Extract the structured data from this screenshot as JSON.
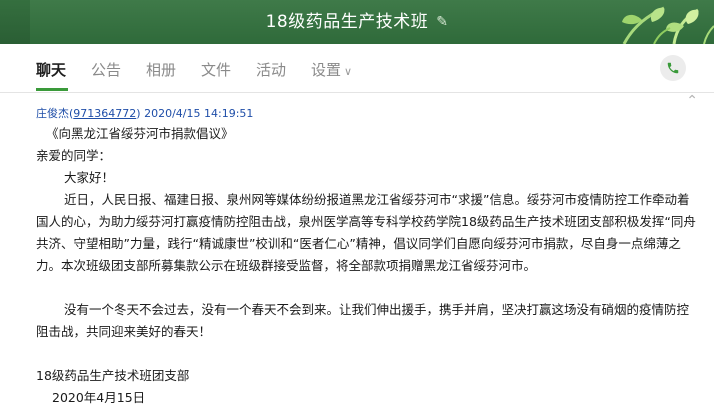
{
  "window": {
    "title": "18级药品生产技术班",
    "edit_icon": "pencil-icon"
  },
  "tabs": [
    {
      "label": "聊天",
      "active": true
    },
    {
      "label": "公告",
      "active": false
    },
    {
      "label": "相册",
      "active": false
    },
    {
      "label": "文件",
      "active": false
    },
    {
      "label": "活动",
      "active": false
    },
    {
      "label": "设置",
      "active": false,
      "has_dropdown": true
    }
  ],
  "call_button_icon": "phone-icon",
  "colors": {
    "titlebar": "#2f6a3a",
    "accent": "#3a9a3a",
    "sender": "#1f4ea8"
  },
  "message": {
    "sender_name": "庄俊杰(",
    "sender_qq": "971364772",
    "sender_close": ")",
    "timestamp": "2020/4/15 14:19:51",
    "lines": {
      "title": "《向黑龙江省绥芬河市捐款倡议》",
      "greeting": "亲爱的同学：",
      "hello": "大家好！",
      "para1": "近日，人民日报、福建日报、泉州网等媒体纷纷报道黑龙江省绥芬河市“求援”信息。绥芬河市疫情防控工作牵动着国人的心，为助力绥芬河打赢疫情防控阻击战，泉州医学高等专科学校药学院18级药品生产技术班团支部积极发挥“同舟共济、守望相助”力量，践行“精诚康世”校训和“医者仁心”精神，倡议同学们自愿向绥芬河市捐款，尽自身一点绵薄之力。本次班级团支部所募集款公示在班级群接受监督，将全部款项捐赠黑龙江省绥芬河市。",
      "para2": "没有一个冬天不会过去，没有一个春天不会到来。让我们伸出援手，携手并肩，坚决打赢这场没有硝烟的疫情防控阻击战，共同迎来美好的春天！",
      "signature": "18级药品生产技术班团支部",
      "date": "2020年4月15日"
    }
  }
}
